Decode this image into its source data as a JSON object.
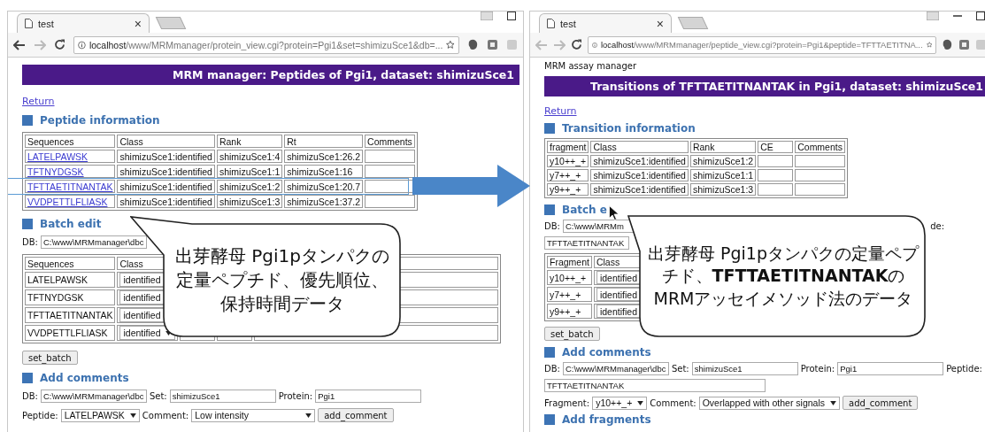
{
  "windows": [
    {
      "tab_title": "test",
      "tab_close": "×",
      "back_enabled": true,
      "forward_enabled": false,
      "url": {
        "host": "localhost",
        "path": "/www/MRMmanager/protein_view.cgi?protein=Pgi1&set=shimizuSce1&db=..."
      },
      "blocks": [
        {
          "kind": "banner",
          "text": "MRM manager: Peptides of Pgi1, dataset: shimizuSce1"
        },
        {
          "kind": "link",
          "text": "Return"
        },
        {
          "kind": "heading",
          "text": "Peptide information"
        },
        {
          "kind": "table",
          "rows": [
            {
              "highlighted": false,
              "cells": [
                {
                  "kind": "text",
                  "text": "Sequences"
                },
                {
                  "kind": "text",
                  "text": "Class"
                },
                {
                  "kind": "text",
                  "text": "Rank"
                },
                {
                  "kind": "text",
                  "text": "Rt"
                },
                {
                  "kind": "text",
                  "text": "Comments"
                }
              ]
            },
            {
              "highlighted": false,
              "cells": [
                {
                  "kind": "link",
                  "text": "LATELPAWSK"
                },
                {
                  "kind": "text",
                  "text": "shimizuSce1:identified"
                },
                {
                  "kind": "text",
                  "text": "shimizuSce1:4"
                },
                {
                  "kind": "text",
                  "text": "shimizuSce1:26.2"
                },
                {
                  "kind": "empty"
                }
              ]
            },
            {
              "highlighted": false,
              "cells": [
                {
                  "kind": "link",
                  "text": "TFTNYDGSK"
                },
                {
                  "kind": "text",
                  "text": "shimizuSce1:identified"
                },
                {
                  "kind": "text",
                  "text": "shimizuSce1:1"
                },
                {
                  "kind": "text",
                  "text": "shimizuSce1:16"
                },
                {
                  "kind": "empty"
                }
              ]
            },
            {
              "highlighted": true,
              "cells": [
                {
                  "kind": "link",
                  "text": "TFTTAETITNANTAK"
                },
                {
                  "kind": "text",
                  "text": "shimizuSce1:identified"
                },
                {
                  "kind": "text",
                  "text": "shimizuSce1:2"
                },
                {
                  "kind": "text",
                  "text": "shimizuSce1:20.7"
                },
                {
                  "kind": "empty"
                }
              ]
            },
            {
              "highlighted": false,
              "cells": [
                {
                  "kind": "link",
                  "text": "VVDPETTLFLIASK"
                },
                {
                  "kind": "text",
                  "text": "shimizuSce1:identified"
                },
                {
                  "kind": "text",
                  "text": "shimizuSce1:3"
                },
                {
                  "kind": "text",
                  "text": "shimizuSce1:37.2"
                },
                {
                  "kind": "empty"
                }
              ]
            }
          ]
        },
        {
          "kind": "heading",
          "text": "Batch edit"
        },
        {
          "kind": "form",
          "lines": [
            [
              {
                "kind": "label",
                "text": "DB:"
              },
              {
                "kind": "field",
                "value": "C:\\www\\MRMmanager\\dbc"
              }
            ]
          ]
        },
        {
          "kind": "table",
          "rows": [
            {
              "highlighted": false,
              "cells": [
                {
                  "kind": "text",
                  "text": "Sequences"
                },
                {
                  "kind": "text",
                  "text": "Class"
                },
                {
                  "kind": "empty"
                },
                {
                  "kind": "empty"
                },
                {
                  "kind": "empty"
                }
              ]
            },
            {
              "highlighted": false,
              "cells": [
                {
                  "kind": "text",
                  "text": "LATELPAWSK"
                },
                {
                  "kind": "select",
                  "value": "identified"
                },
                {
                  "kind": "empty"
                },
                {
                  "kind": "empty"
                },
                {
                  "kind": "wide_empty"
                }
              ]
            },
            {
              "highlighted": false,
              "cells": [
                {
                  "kind": "text",
                  "text": "TFTNYDGSK"
                },
                {
                  "kind": "select",
                  "value": "identified"
                },
                {
                  "kind": "empty"
                },
                {
                  "kind": "empty"
                },
                {
                  "kind": "wide_empty"
                }
              ]
            },
            {
              "highlighted": false,
              "cells": [
                {
                  "kind": "text",
                  "text": "TFTTAETITNANTAK"
                },
                {
                  "kind": "select",
                  "value": "identified"
                },
                {
                  "kind": "empty"
                },
                {
                  "kind": "empty"
                },
                {
                  "kind": "wide_empty"
                }
              ]
            },
            {
              "highlighted": false,
              "cells": [
                {
                  "kind": "text",
                  "text": "VVDPETTLFLIASK"
                },
                {
                  "kind": "select",
                  "value": "identified"
                },
                {
                  "kind": "empty"
                },
                {
                  "kind": "empty"
                },
                {
                  "kind": "wide_empty"
                }
              ]
            }
          ]
        },
        {
          "kind": "button",
          "text": "set_batch"
        },
        {
          "kind": "heading",
          "text": "Add comments"
        },
        {
          "kind": "form",
          "lines": [
            [
              {
                "kind": "label",
                "text": "DB:"
              },
              {
                "kind": "field",
                "value": "C:\\www\\MRMmanager\\dbc"
              },
              {
                "kind": "label",
                "text": "Set:"
              },
              {
                "kind": "field",
                "value": "shimizuSce1"
              },
              {
                "kind": "label",
                "text": "Protein:"
              },
              {
                "kind": "field",
                "value": "Pgi1"
              }
            ],
            [
              {
                "kind": "label",
                "text": "Peptide:"
              },
              {
                "kind": "select",
                "value": "LATELPAWSK"
              },
              {
                "kind": "label",
                "text": "Comment:"
              },
              {
                "kind": "long_select",
                "value": "Low intensity"
              },
              {
                "kind": "button",
                "text": "add_comment"
              }
            ]
          ]
        }
      ]
    },
    {
      "tab_title": "test",
      "tab_close": "×",
      "back_enabled": false,
      "forward_enabled": false,
      "url": {
        "host": "localhost",
        "path": "/www/MRMmanager/peptide_view.cgi?protein=Pgi1&peptide=TFTTAETITNA..."
      },
      "blocks": [
        {
          "kind": "site_label",
          "text": "MRM assay manager"
        },
        {
          "kind": "banner",
          "text": "Transitions of TFTTAETITNANTAK in Pgi1, dataset: shimizuSce1"
        },
        {
          "kind": "link",
          "text": "Return"
        },
        {
          "kind": "heading",
          "text": "Transition information"
        },
        {
          "kind": "table",
          "rows": [
            {
              "highlighted": false,
              "cells": [
                {
                  "kind": "text",
                  "text": "fragment"
                },
                {
                  "kind": "text",
                  "text": "Class"
                },
                {
                  "kind": "text",
                  "text": "Rank"
                },
                {
                  "kind": "text",
                  "text": "CE"
                },
                {
                  "kind": "text",
                  "text": "Comments"
                }
              ]
            },
            {
              "highlighted": false,
              "cells": [
                {
                  "kind": "text",
                  "text": "y10++_+"
                },
                {
                  "kind": "text",
                  "text": "shimizuSce1:identified"
                },
                {
                  "kind": "text",
                  "text": "shimizuSce1:2"
                },
                {
                  "kind": "empty"
                },
                {
                  "kind": "empty"
                }
              ]
            },
            {
              "highlighted": false,
              "cells": [
                {
                  "kind": "text",
                  "text": "y7++_+"
                },
                {
                  "kind": "text",
                  "text": "shimizuSce1:identified"
                },
                {
                  "kind": "text",
                  "text": "shimizuSce1:1"
                },
                {
                  "kind": "empty"
                },
                {
                  "kind": "empty"
                }
              ]
            },
            {
              "highlighted": false,
              "cells": [
                {
                  "kind": "text",
                  "text": "y9++_+"
                },
                {
                  "kind": "text",
                  "text": "shimizuSce1:identified"
                },
                {
                  "kind": "text",
                  "text": "shimizuSce1:3"
                },
                {
                  "kind": "empty"
                },
                {
                  "kind": "empty"
                }
              ]
            }
          ]
        },
        {
          "kind": "heading",
          "text": "Batch e"
        },
        {
          "kind": "form",
          "lines": [
            [
              {
                "kind": "label",
                "text": "DB:"
              },
              {
                "kind": "short_field",
                "value": "C:\\www\\MRMm"
              },
              {
                "kind": "right_label",
                "text": "de:"
              }
            ],
            [
              {
                "kind": "mid_field",
                "value": "TFTTAETITNANTAK"
              }
            ]
          ]
        },
        {
          "kind": "table",
          "rows": [
            {
              "highlighted": false,
              "cells": [
                {
                  "kind": "text",
                  "text": "Fragment"
                },
                {
                  "kind": "text",
                  "text": "Class"
                }
              ]
            },
            {
              "highlighted": false,
              "cells": [
                {
                  "kind": "text",
                  "text": "y10++_+"
                },
                {
                  "kind": "select",
                  "value": "identified"
                }
              ]
            },
            {
              "highlighted": false,
              "cells": [
                {
                  "kind": "text",
                  "text": "y7++_+"
                },
                {
                  "kind": "select",
                  "value": "identified"
                }
              ]
            },
            {
              "highlighted": false,
              "cells": [
                {
                  "kind": "text",
                  "text": "y9++_+"
                },
                {
                  "kind": "select",
                  "value": "identified"
                }
              ]
            }
          ]
        },
        {
          "kind": "button",
          "text": "set_batch"
        },
        {
          "kind": "heading",
          "text": "Add comments"
        },
        {
          "kind": "form",
          "lines": [
            [
              {
                "kind": "label",
                "text": "DB:"
              },
              {
                "kind": "field",
                "value": "C:\\www\\MRMmanager\\dbc"
              },
              {
                "kind": "label",
                "text": "Set:"
              },
              {
                "kind": "field",
                "value": "shimizuSce1"
              },
              {
                "kind": "label",
                "text": "Protein:"
              },
              {
                "kind": "field",
                "value": "Pgi1"
              },
              {
                "kind": "label",
                "text": "Peptide:"
              }
            ],
            [
              {
                "kind": "long_field",
                "value": "TFTTAETITNANTAK"
              }
            ],
            [
              {
                "kind": "label",
                "text": "Fragment:"
              },
              {
                "kind": "select",
                "value": "y10++_+"
              },
              {
                "kind": "label",
                "text": "Comment:"
              },
              {
                "kind": "long_select",
                "value": "Overlapped with other signals"
              },
              {
                "kind": "button",
                "text": "add_comment"
              }
            ]
          ]
        },
        {
          "kind": "heading",
          "text": "Add fragments"
        }
      ]
    }
  ],
  "callouts": [
    {
      "text": "出芽酵母 Pgi1pタンパクの定量ペプチド、優先順位、保持時間データ"
    },
    {
      "text": "出芽酵母 Pgi1pタンパクの定量ペプチド、**TFTTAETITNANTAK**のMRMアッセイメソッド法のデータ"
    }
  ]
}
